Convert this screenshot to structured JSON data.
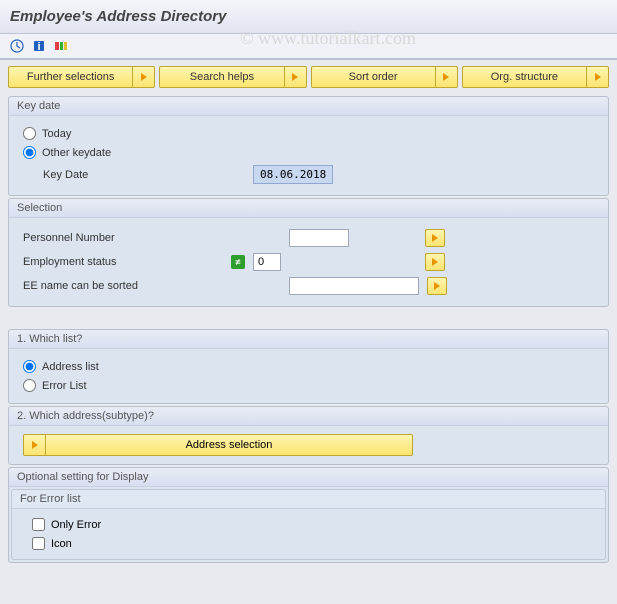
{
  "header": {
    "title": "Employee's Address Directory"
  },
  "watermark": "© www.tutorialkart.com",
  "buttons": {
    "further_selections": "Further selections",
    "search_helps": "Search helps",
    "sort_order": "Sort order",
    "org_structure": "Org. structure"
  },
  "keydate": {
    "group_title": "Key date",
    "today_label": "Today",
    "other_label": "Other keydate",
    "field_label": "Key Date",
    "value": "08.06.2018",
    "selected": "other"
  },
  "selection": {
    "group_title": "Selection",
    "personnel_label": "Personnel Number",
    "personnel_value": "",
    "employment_label": "Employment status",
    "employment_value": "0",
    "employment_operator": "≠",
    "eename_label": "EE name can be sorted",
    "eename_value": ""
  },
  "which_list": {
    "group_title": "1. Which list?",
    "address_label": "Address list",
    "error_label": "Error List",
    "selected": "address"
  },
  "which_address": {
    "group_title": "2. Which address(subtype)?",
    "button_label": "Address selection"
  },
  "optional": {
    "group_title": "Optional setting for Display",
    "subgroup_title": "For Error list",
    "only_error_label": "Only Error",
    "only_error_checked": false,
    "icon_label": "Icon",
    "icon_checked": false
  }
}
